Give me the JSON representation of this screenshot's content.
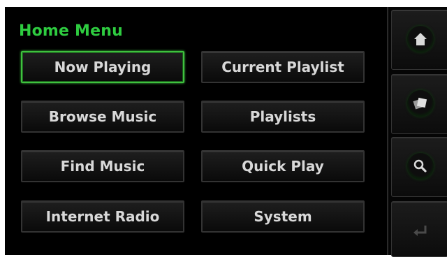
{
  "menu": {
    "title": "Home Menu",
    "items": [
      {
        "label": "Now Playing",
        "selected": true
      },
      {
        "label": "Current Playlist",
        "selected": false
      },
      {
        "label": "Browse Music",
        "selected": false
      },
      {
        "label": "Playlists",
        "selected": false
      },
      {
        "label": "Find Music",
        "selected": false
      },
      {
        "label": "Quick Play",
        "selected": false
      },
      {
        "label": "Internet Radio",
        "selected": false
      },
      {
        "label": "System",
        "selected": false
      }
    ]
  },
  "sidebar": {
    "buttons": [
      {
        "icon": "home-icon"
      },
      {
        "icon": "albums-icon"
      },
      {
        "icon": "search-icon"
      },
      {
        "icon": "enter-return-icon"
      }
    ]
  },
  "colors": {
    "title": "#2ecc40",
    "selected_border": "#3fc13f",
    "button_text": "#d8d8d8",
    "background": "#000000"
  }
}
